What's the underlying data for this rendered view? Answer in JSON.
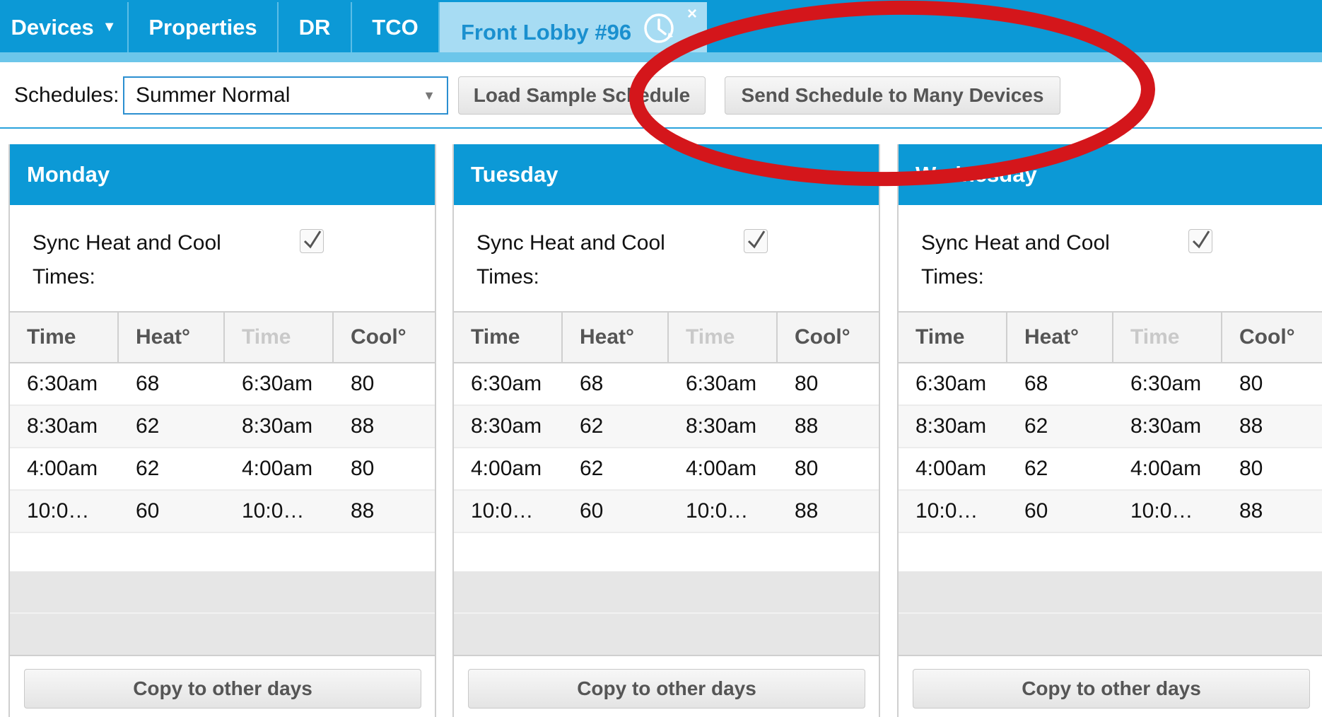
{
  "nav": {
    "tabs": [
      {
        "label": "Devices"
      },
      {
        "label": "Properties"
      },
      {
        "label": "DR"
      },
      {
        "label": "TCO"
      },
      {
        "label": "Front Lobby #96"
      }
    ],
    "close_glyph": "×"
  },
  "toolbar": {
    "schedules_label": "Schedules:",
    "schedule_value": "Summer Normal",
    "load_sample_label": "Load Sample Schedule",
    "send_many_label": "Send Schedule to Many Devices"
  },
  "days": [
    {
      "name": "Monday",
      "sync_label": "Sync Heat and Cool Times:",
      "sync_checked": true,
      "headers": [
        "Time",
        "Heat°",
        "Time",
        "Cool°"
      ],
      "rows": [
        [
          "6:30am",
          "68",
          "6:30am",
          "80"
        ],
        [
          "8:30am",
          "62",
          "8:30am",
          "88"
        ],
        [
          "4:00am",
          "62",
          "4:00am",
          "80"
        ],
        [
          "10:0…",
          "60",
          "10:0…",
          "88"
        ]
      ],
      "copy_label": "Copy to other days"
    },
    {
      "name": "Tuesday",
      "sync_label": "Sync Heat and Cool Times:",
      "sync_checked": true,
      "headers": [
        "Time",
        "Heat°",
        "Time",
        "Cool°"
      ],
      "rows": [
        [
          "6:30am",
          "68",
          "6:30am",
          "80"
        ],
        [
          "8:30am",
          "62",
          "8:30am",
          "88"
        ],
        [
          "4:00am",
          "62",
          "4:00am",
          "80"
        ],
        [
          "10:0…",
          "60",
          "10:0…",
          "88"
        ]
      ],
      "copy_label": "Copy to other days"
    },
    {
      "name": "Wednesday",
      "sync_label": "Sync Heat and Cool Times:",
      "sync_checked": true,
      "headers": [
        "Time",
        "Heat°",
        "Time",
        "Cool°"
      ],
      "rows": [
        [
          "6:30am",
          "68",
          "6:30am",
          "80"
        ],
        [
          "8:30am",
          "62",
          "8:30am",
          "88"
        ],
        [
          "4:00am",
          "62",
          "4:00am",
          "80"
        ],
        [
          "10:0…",
          "60",
          "10:0…",
          "88"
        ]
      ],
      "copy_label": "Copy to other days"
    }
  ],
  "colors": {
    "nav_blue": "#0c99d6",
    "active_tab": "#a7dcf3",
    "annotation_red": "#d4161b"
  },
  "icons": [
    "chevron-down-icon",
    "clock-icon",
    "close-icon",
    "checkmark-icon"
  ]
}
